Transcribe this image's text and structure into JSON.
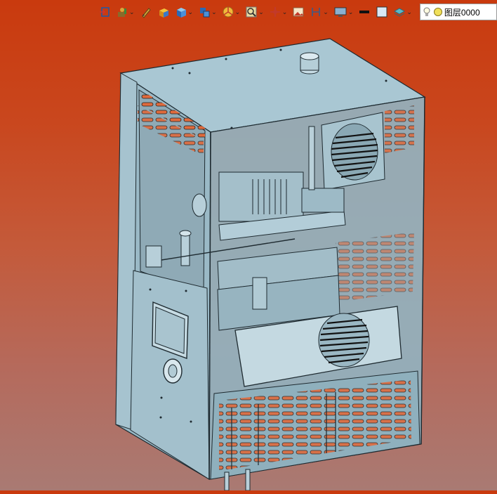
{
  "toolbar": {
    "items": [
      {
        "icon": "view-fit-icon",
        "has_dropdown": false
      },
      {
        "icon": "display-style-icon",
        "has_dropdown": true
      },
      {
        "icon": "sketch-pen-icon",
        "has_dropdown": false
      },
      {
        "icon": "box-solid-icon",
        "has_dropdown": false
      },
      {
        "icon": "cube-view-icon",
        "has_dropdown": true
      },
      {
        "icon": "cube-section-icon",
        "has_dropdown": true
      },
      {
        "icon": "appearance-wheel-icon",
        "has_dropdown": true
      },
      {
        "icon": "zoom-icon",
        "has_dropdown": true
      },
      {
        "icon": "move-axes-icon",
        "has_dropdown": true
      },
      {
        "icon": "image-render-icon",
        "has_dropdown": false
      },
      {
        "icon": "section-view-icon",
        "has_dropdown": true
      },
      {
        "icon": "monitor-icon",
        "has_dropdown": true
      },
      {
        "icon": "line-color-icon",
        "has_dropdown": false
      },
      {
        "icon": "fill-color-icon",
        "has_dropdown": false
      },
      {
        "icon": "layers-icon",
        "has_dropdown": true
      }
    ],
    "layer": {
      "label": "图层0000"
    }
  },
  "colors": {
    "bg_top": "#c93a0e",
    "bg_bottom": "#a97a73",
    "housing": "#9fbfcc",
    "housing_dark": "#7e9eab",
    "slot": "#e06a3c",
    "outline": "#1e2a30"
  }
}
